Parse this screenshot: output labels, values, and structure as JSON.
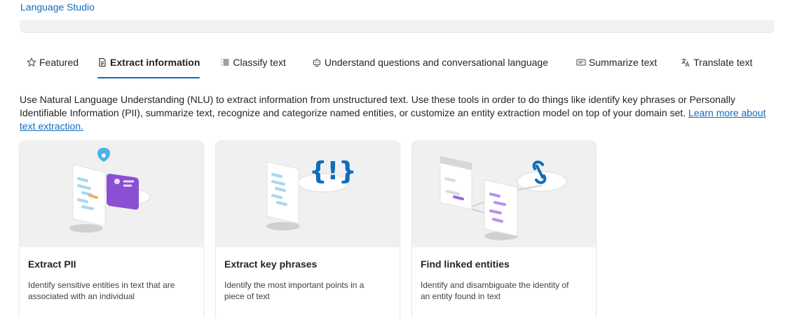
{
  "app": {
    "title": "Language Studio"
  },
  "tabs": [
    {
      "label": "Featured",
      "icon": "star-icon"
    },
    {
      "label": "Extract information",
      "icon": "document-icon",
      "active": true
    },
    {
      "label": "Classify text",
      "icon": "list-icon"
    },
    {
      "label": "Understand questions and conversational language",
      "icon": "bot-icon"
    },
    {
      "label": "Summarize text",
      "icon": "text-box-icon"
    },
    {
      "label": "Translate text",
      "icon": "translate-icon"
    }
  ],
  "description": {
    "text": "Use Natural Language Understanding (NLU) to extract information from unstructured text. Use these tools in order to do things like identify key phrases or Personally Identifiable Information (PII), summarize text, recognize and categorize named entities, or customize an entity extraction model on top of your domain set. ",
    "link": "Learn more about text extraction."
  },
  "cards": [
    {
      "title": "Extract PII",
      "text": "Identify sensitive entities in text that are associated with an individual",
      "illustration": "pii-illustration"
    },
    {
      "title": "Extract key phrases",
      "text": "Identify the most important points in a piece of text",
      "illustration": "key-phrases-illustration"
    },
    {
      "title": "Find linked entities",
      "text": "Identify and disambiguate the identity of an entity found in text",
      "illustration": "linked-entities-illustration"
    }
  ],
  "colors": {
    "accent": "#0f6cbd",
    "purple": "#8a4fd3",
    "light_blue": "#4cb4e7"
  }
}
